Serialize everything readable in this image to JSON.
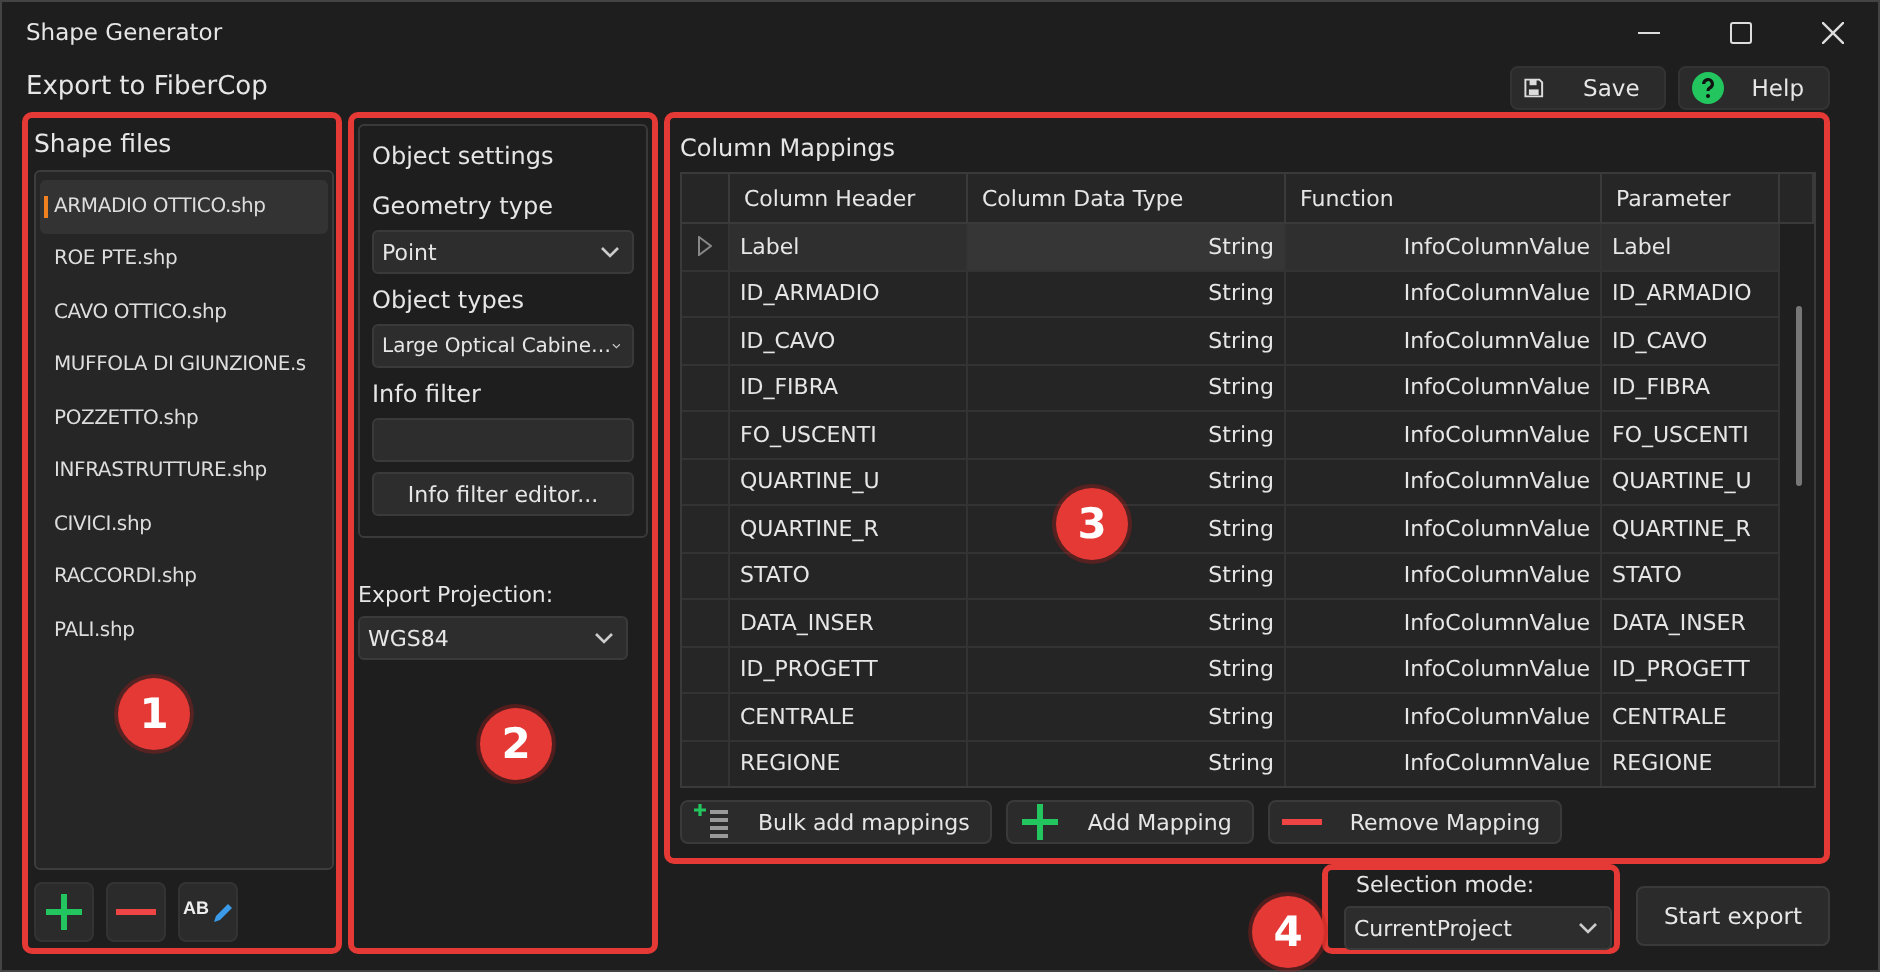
{
  "window": {
    "title": "Shape Generator"
  },
  "header": {
    "title": "Export to FiberCop",
    "buttons": [
      {
        "kind": "save",
        "label": "Save"
      },
      {
        "kind": "help",
        "label": "Help"
      }
    ]
  },
  "shape_files": {
    "callout": "1",
    "title": "Shape files",
    "items": [
      {
        "label": "ARMADIO OTTICO.shp",
        "selected": true
      },
      {
        "label": "ROE PTE.shp",
        "selected": false
      },
      {
        "label": "CAVO OTTICO.shp",
        "selected": false
      },
      {
        "label": "MUFFOLA DI GIUNZIONE.s",
        "selected": false
      },
      {
        "label": "POZZETTO.shp",
        "selected": false
      },
      {
        "label": "INFRASTRUTTURE.shp",
        "selected": false
      },
      {
        "label": "CIVICI.shp",
        "selected": false
      },
      {
        "label": "RACCORDI.shp",
        "selected": false
      },
      {
        "label": "PALI.shp",
        "selected": false
      }
    ],
    "buttons": [
      {
        "kind": "add"
      },
      {
        "kind": "remove"
      },
      {
        "kind": "rename",
        "label": "AB"
      }
    ]
  },
  "object_settings": {
    "callout": "2",
    "title": "Object settings",
    "geometry_type": {
      "label": "Geometry type",
      "value": "Point"
    },
    "object_types": {
      "label": "Object types",
      "value": "Large Optical Cabine…"
    },
    "info_filter": {
      "label": "Info filter"
    },
    "info_filter_button": "Info filter editor...",
    "export_projection": {
      "label": "Export Projection:",
      "value": "WGS84"
    }
  },
  "column_mappings": {
    "callout": "3",
    "title": "Column Mappings",
    "columns": [
      "Column Header",
      "Column Data Type",
      "Function",
      "Parameter"
    ],
    "rows": [
      {
        "cells": [
          "Label",
          "String",
          "InfoColumnValue",
          "Label"
        ],
        "selected": true
      },
      {
        "cells": [
          "ID_ARMADIO",
          "String",
          "InfoColumnValue",
          "ID_ARMADIO"
        ],
        "selected": false
      },
      {
        "cells": [
          "ID_CAVO",
          "String",
          "InfoColumnValue",
          "ID_CAVO"
        ],
        "selected": false
      },
      {
        "cells": [
          "ID_FIBRA",
          "String",
          "InfoColumnValue",
          "ID_FIBRA"
        ],
        "selected": false
      },
      {
        "cells": [
          "FO_USCENTI",
          "String",
          "InfoColumnValue",
          "FO_USCENTI"
        ],
        "selected": false
      },
      {
        "cells": [
          "QUARTINE_U",
          "String",
          "InfoColumnValue",
          "QUARTINE_U"
        ],
        "selected": false
      },
      {
        "cells": [
          "QUARTINE_R",
          "String",
          "InfoColumnValue",
          "QUARTINE_R"
        ],
        "selected": false
      },
      {
        "cells": [
          "STATO",
          "String",
          "InfoColumnValue",
          "STATO"
        ],
        "selected": false
      },
      {
        "cells": [
          "DATA_INSER",
          "String",
          "InfoColumnValue",
          "DATA_INSER"
        ],
        "selected": false
      },
      {
        "cells": [
          "ID_PROGETT",
          "String",
          "InfoColumnValue",
          "ID_PROGETT"
        ],
        "selected": false
      },
      {
        "cells": [
          "CENTRALE",
          "String",
          "InfoColumnValue",
          "CENTRALE"
        ],
        "selected": false
      },
      {
        "cells": [
          "REGIONE",
          "String",
          "InfoColumnValue",
          "REGIONE"
        ],
        "selected": false
      }
    ],
    "buttons": [
      {
        "kind": "bulk",
        "label": "Bulk add mappings"
      },
      {
        "kind": "add",
        "label": "Add Mapping"
      },
      {
        "kind": "remove",
        "label": "Remove Mapping"
      }
    ]
  },
  "selection_mode": {
    "callout": "4",
    "label": "Selection mode:",
    "value": "CurrentProject"
  },
  "start_export": "Start export"
}
